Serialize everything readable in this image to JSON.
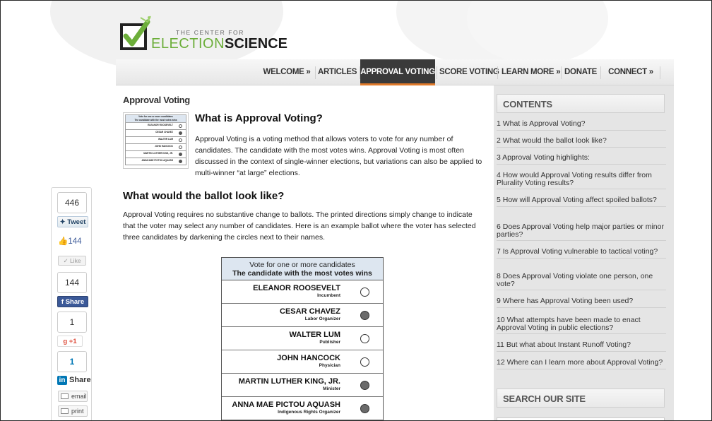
{
  "logo": {
    "small": "THE CENTER FOR",
    "big_light": "ELECTION",
    "big_dark": "SCIENCE"
  },
  "nav": [
    {
      "label": "WELCOME »"
    },
    {
      "label": "ARTICLES"
    },
    {
      "label": "APPROVAL VOTING",
      "active": true
    },
    {
      "label": "SCORE VOTING"
    },
    {
      "label": "LEARN MORE »"
    },
    {
      "label": "DONATE"
    },
    {
      "label": "CONNECT »"
    }
  ],
  "main": {
    "breadcrumb": "Approval Voting",
    "heading1": "What is Approval Voting?",
    "para1": "Approval Voting is a voting method that allows voters to vote for any number of candidates. The candidate with the most votes wins. Approval Voting is most often discussed in the context of single-winner elections, but variations can also be applied to multi-winner “at large” elections.",
    "heading2": "What would the ballot look like?",
    "para2": "Approval Voting requires no substantive change to ballots. The printed directions simply change to indicate that the voter may select any number of candidates. Here is an example ballot where the voter has selected three candidates by darkening the circles next to their names."
  },
  "ballot": {
    "header_line1": "Vote for one or more candidates",
    "header_line2": "The candidate with the most votes wins",
    "candidates": [
      {
        "name": "ELEANOR ROOSEVELT",
        "role": "Incumbent",
        "selected": false
      },
      {
        "name": "CESAR CHAVEZ",
        "role": "Labor Organizer",
        "selected": true
      },
      {
        "name": "WALTER LUM",
        "role": "Publisher",
        "selected": false
      },
      {
        "name": "JOHN HANCOCK",
        "role": "Physician",
        "selected": false
      },
      {
        "name": "MARTIN LUTHER KING, JR.",
        "role": "Minister",
        "selected": true
      },
      {
        "name": "ANNA MAE PICTOU AQUASH",
        "role": "Indigenous Rights Organizer",
        "selected": true
      }
    ]
  },
  "sidebar": {
    "contents_title": "CONTENTS",
    "toc": [
      "1 What is Approval Voting?",
      "2 What would the ballot look like?",
      "3 Approval Voting highlights:",
      "4 How would Approval Voting results differ from Plurality Voting results?",
      "5 How will Approval Voting affect spoiled ballots?",
      "6 Does Approval Voting help major parties or minor parties?",
      "7 Is Approval Voting vulnerable to tactical voting?",
      "8 Does Approval Voting violate one person, one vote?",
      "9 Where has Approval Voting been used?",
      "10 What attempts have been made to enact Approval Voting in public elections?",
      "11 But what about Instant Runoff Voting?",
      "12 Where can I learn more about Approval Voting?"
    ],
    "search_title": "SEARCH OUR SITE"
  },
  "share": {
    "tweet_count": "446",
    "tweet_label": "Tweet",
    "like_count": "144",
    "like_label": "Like",
    "fb_count": "144",
    "fb_label": "Share",
    "gplus_count": "1",
    "gplus_label": "+1",
    "linkedin_count": "1",
    "linkedin_label": "Share",
    "email_label": "email",
    "print_label": "print"
  },
  "colors": {
    "nav_active_bg": "#3a3a3a",
    "nav_active_accent": "#e07a2a",
    "logo_green": "#6cae3a",
    "ballot_header": "#dde6f0",
    "sidebar_bg": "#e5e5e5"
  }
}
